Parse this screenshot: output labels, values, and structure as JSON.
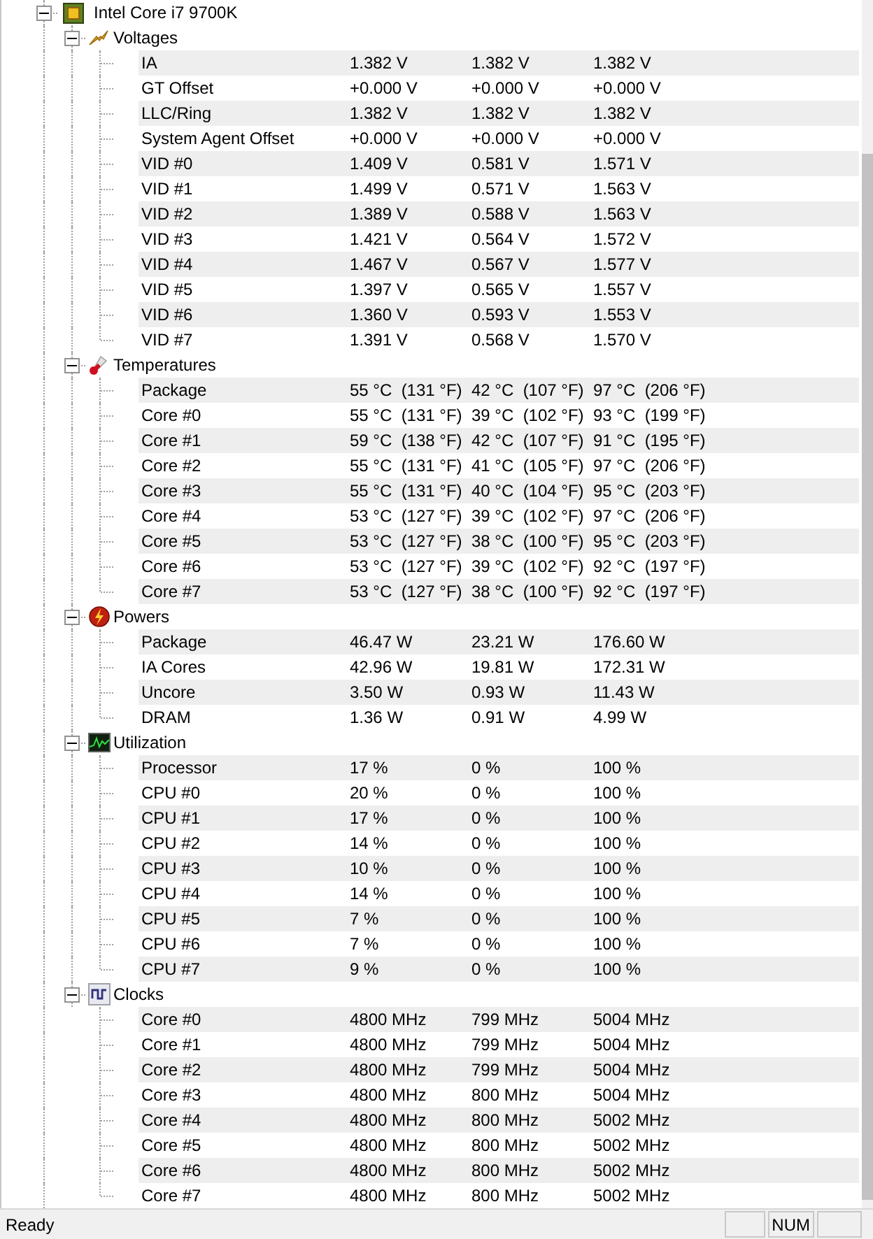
{
  "device": {
    "name": "Intel Core i7 9700K",
    "expanded": true
  },
  "groups": [
    {
      "name": "Voltages",
      "kind": "voltage",
      "expanded": true,
      "sensors": [
        {
          "name": "IA",
          "values": [
            "1.382 V",
            "1.382 V",
            "1.382 V"
          ]
        },
        {
          "name": "GT Offset",
          "values": [
            "+0.000 V",
            "+0.000 V",
            "+0.000 V"
          ]
        },
        {
          "name": "LLC/Ring",
          "values": [
            "1.382 V",
            "1.382 V",
            "1.382 V"
          ]
        },
        {
          "name": "System Agent Offset",
          "values": [
            "+0.000 V",
            "+0.000 V",
            "+0.000 V"
          ]
        },
        {
          "name": "VID #0",
          "values": [
            "1.409 V",
            "0.581 V",
            "1.571 V"
          ]
        },
        {
          "name": "VID #1",
          "values": [
            "1.499 V",
            "0.571 V",
            "1.563 V"
          ]
        },
        {
          "name": "VID #2",
          "values": [
            "1.389 V",
            "0.588 V",
            "1.563 V"
          ]
        },
        {
          "name": "VID #3",
          "values": [
            "1.421 V",
            "0.564 V",
            "1.572 V"
          ]
        },
        {
          "name": "VID #4",
          "values": [
            "1.467 V",
            "0.567 V",
            "1.577 V"
          ]
        },
        {
          "name": "VID #5",
          "values": [
            "1.397 V",
            "0.565 V",
            "1.557 V"
          ]
        },
        {
          "name": "VID #6",
          "values": [
            "1.360 V",
            "0.593 V",
            "1.553 V"
          ]
        },
        {
          "name": "VID #7",
          "values": [
            "1.391 V",
            "0.568 V",
            "1.570 V"
          ]
        }
      ]
    },
    {
      "name": "Temperatures",
      "kind": "temperature",
      "expanded": true,
      "sensors": [
        {
          "name": "Package",
          "values": [
            "55 °C  (131 °F)",
            "42 °C  (107 °F)",
            "97 °C  (206 °F)"
          ]
        },
        {
          "name": "Core #0",
          "values": [
            "55 °C  (131 °F)",
            "39 °C  (102 °F)",
            "93 °C  (199 °F)"
          ]
        },
        {
          "name": "Core #1",
          "values": [
            "59 °C  (138 °F)",
            "42 °C  (107 °F)",
            "91 °C  (195 °F)"
          ]
        },
        {
          "name": "Core #2",
          "values": [
            "55 °C  (131 °F)",
            "41 °C  (105 °F)",
            "97 °C  (206 °F)"
          ]
        },
        {
          "name": "Core #3",
          "values": [
            "55 °C  (131 °F)",
            "40 °C  (104 °F)",
            "95 °C  (203 °F)"
          ]
        },
        {
          "name": "Core #4",
          "values": [
            "53 °C  (127 °F)",
            "39 °C  (102 °F)",
            "97 °C  (206 °F)"
          ]
        },
        {
          "name": "Core #5",
          "values": [
            "53 °C  (127 °F)",
            "38 °C  (100 °F)",
            "95 °C  (203 °F)"
          ]
        },
        {
          "name": "Core #6",
          "values": [
            "53 °C  (127 °F)",
            "39 °C  (102 °F)",
            "92 °C  (197 °F)"
          ]
        },
        {
          "name": "Core #7",
          "values": [
            "53 °C  (127 °F)",
            "38 °C  (100 °F)",
            "92 °C  (197 °F)"
          ]
        }
      ]
    },
    {
      "name": "Powers",
      "kind": "power",
      "expanded": true,
      "sensors": [
        {
          "name": "Package",
          "values": [
            "46.47 W",
            "23.21 W",
            "176.60 W"
          ]
        },
        {
          "name": "IA Cores",
          "values": [
            "42.96 W",
            "19.81 W",
            "172.31 W"
          ]
        },
        {
          "name": "Uncore",
          "values": [
            "3.50 W",
            "0.93 W",
            "11.43 W"
          ]
        },
        {
          "name": "DRAM",
          "values": [
            "1.36 W",
            "0.91 W",
            "4.99 W"
          ]
        }
      ]
    },
    {
      "name": "Utilization",
      "kind": "utilization",
      "expanded": true,
      "sensors": [
        {
          "name": "Processor",
          "values": [
            "17 %",
            "0 %",
            "100 %"
          ]
        },
        {
          "name": "CPU #0",
          "values": [
            "20 %",
            "0 %",
            "100 %"
          ]
        },
        {
          "name": "CPU #1",
          "values": [
            "17 %",
            "0 %",
            "100 %"
          ]
        },
        {
          "name": "CPU #2",
          "values": [
            "14 %",
            "0 %",
            "100 %"
          ]
        },
        {
          "name": "CPU #3",
          "values": [
            "10 %",
            "0 %",
            "100 %"
          ]
        },
        {
          "name": "CPU #4",
          "values": [
            "14 %",
            "0 %",
            "100 %"
          ]
        },
        {
          "name": "CPU #5",
          "values": [
            "7 %",
            "0 %",
            "100 %"
          ]
        },
        {
          "name": "CPU #6",
          "values": [
            "7 %",
            "0 %",
            "100 %"
          ]
        },
        {
          "name": "CPU #7",
          "values": [
            "9 %",
            "0 %",
            "100 %"
          ]
        }
      ]
    },
    {
      "name": "Clocks",
      "kind": "clock",
      "expanded": true,
      "sensors": [
        {
          "name": "Core #0",
          "values": [
            "4800 MHz",
            "799 MHz",
            "5004 MHz"
          ]
        },
        {
          "name": "Core #1",
          "values": [
            "4800 MHz",
            "799 MHz",
            "5004 MHz"
          ]
        },
        {
          "name": "Core #2",
          "values": [
            "4800 MHz",
            "799 MHz",
            "5004 MHz"
          ]
        },
        {
          "name": "Core #3",
          "values": [
            "4800 MHz",
            "800 MHz",
            "5004 MHz"
          ]
        },
        {
          "name": "Core #4",
          "values": [
            "4800 MHz",
            "800 MHz",
            "5002 MHz"
          ]
        },
        {
          "name": "Core #5",
          "values": [
            "4800 MHz",
            "800 MHz",
            "5002 MHz"
          ]
        },
        {
          "name": "Core #6",
          "values": [
            "4800 MHz",
            "800 MHz",
            "5002 MHz"
          ]
        },
        {
          "name": "Core #7",
          "values": [
            "4800 MHz",
            "800 MHz",
            "5002 MHz"
          ]
        }
      ]
    }
  ],
  "status_bar": {
    "text": "Ready",
    "indicators": [
      {
        "label": "NUM"
      }
    ]
  }
}
